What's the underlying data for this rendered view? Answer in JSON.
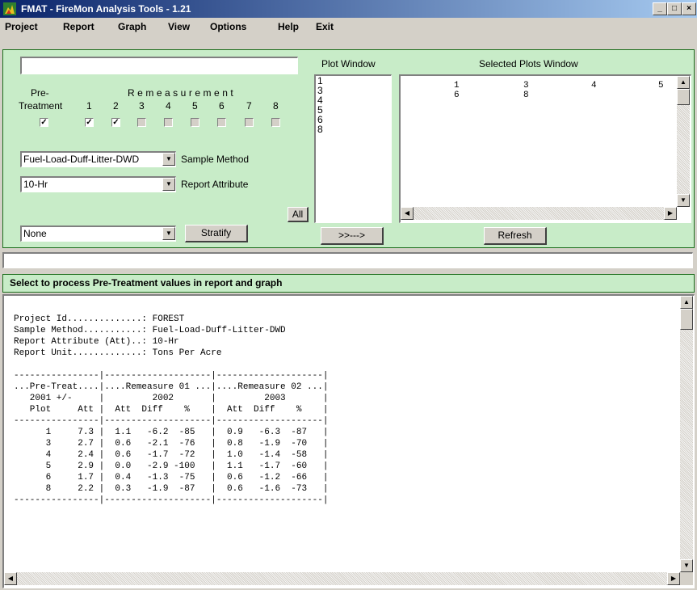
{
  "window": {
    "title": "FMAT - FireMon Analysis Tools  - 1.21"
  },
  "menu": [
    "Project",
    "Report",
    "Graph",
    "View",
    "Options",
    "Help",
    "Exit"
  ],
  "selection": {
    "project_field_value": "",
    "pre_label_1": "Pre-",
    "pre_label_2": "Treatment",
    "remeasurement_label": "Remeasurement",
    "remeasure_numbers": [
      "1",
      "2",
      "3",
      "4",
      "5",
      "6",
      "7",
      "8"
    ],
    "pre_checked": true,
    "remeasure_checked": [
      true,
      true,
      false,
      false,
      false,
      false,
      false,
      false
    ],
    "sample_method_value": "Fuel-Load-Duff-Litter-DWD",
    "sample_method_label": "Sample Method",
    "report_attribute_value": "10-Hr",
    "report_attribute_label": "Report Attribute",
    "all_button": "All",
    "stratify_value": "None",
    "stratify_button": "Stratify"
  },
  "plot_window": {
    "label": "Plot Window",
    "items": [
      "1",
      "3",
      "4",
      "5",
      "6",
      "8"
    ],
    "move_button": ">>--->"
  },
  "selected_plots": {
    "label": "Selected Plots Window",
    "row1": [
      "1",
      "3",
      "4",
      "5"
    ],
    "row2": [
      "6",
      "8"
    ],
    "refresh_button": "Refresh"
  },
  "status_text": "",
  "hint_text": "Select to process Pre-Treatment values in report and graph",
  "report": {
    "lines": [
      "",
      "Project Id..............: FOREST",
      "Sample Method...........: Fuel-Load-Duff-Litter-DWD",
      "Report Attribute (Att)..: 10-Hr",
      "Report Unit.............: Tons Per Acre",
      "",
      "----------------|--------------------|--------------------|",
      "...Pre-Treat....|....Remeasure 01 ...|....Remeasure 02 ...|",
      "   2001 +/-     |         2002       |         2003       |",
      "   Plot     Att |  Att  Diff    %    |  Att  Diff    %    |",
      "----------------|--------------------|--------------------|",
      "      1     7.3 |  1.1   -6.2  -85   |  0.9   -6.3  -87   |",
      "      3     2.7 |  0.6   -2.1  -76   |  0.8   -1.9  -70   |",
      "      4     2.4 |  0.6   -1.7  -72   |  1.0   -1.4  -58   |",
      "      5     2.9 |  0.0   -2.9 -100   |  1.1   -1.7  -60   |",
      "      6     1.7 |  0.4   -1.3  -75   |  0.6   -1.2  -66   |",
      "      8     2.2 |  0.3   -1.9  -87   |  0.6   -1.6  -73   |",
      "----------------|--------------------|--------------------|"
    ]
  },
  "colors": {
    "panel_green": "#c8ecc8",
    "border_green": "#1d6e1d",
    "title_blue": "#0a246a"
  },
  "icons": [
    "fmat-app-icon",
    "minimize-icon",
    "maximize-icon",
    "close-icon",
    "dropdown-arrow-icon",
    "scroll-up-icon",
    "scroll-down-icon",
    "scroll-left-icon",
    "scroll-right-icon"
  ]
}
